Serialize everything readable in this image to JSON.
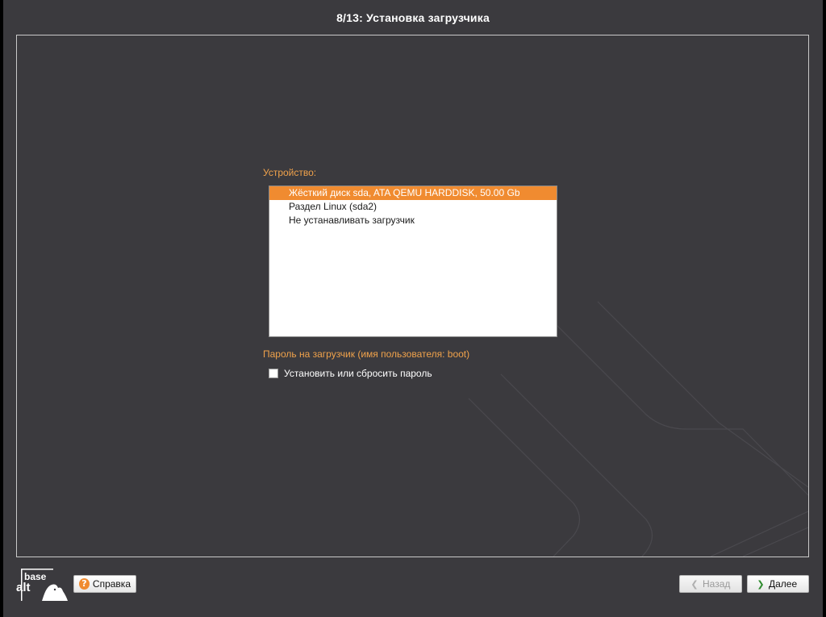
{
  "window": {
    "title": "8/13: Установка загрузчика"
  },
  "device": {
    "label": "Устройство:",
    "items": [
      {
        "label": "Жёсткий диск sda, ATA QEMU HARDDISK, 50.00 Gb",
        "selected": true
      },
      {
        "label": "Раздел Linux (sda2)",
        "selected": false
      },
      {
        "label": "Не устанавливать загрузчик",
        "selected": false
      }
    ]
  },
  "password": {
    "label": "Пароль на загрузчик (имя пользователя: boot)",
    "checkbox_label": "Установить или сбросить пароль",
    "checked": false
  },
  "logo": {
    "line1": "base",
    "line2": "alt"
  },
  "footer": {
    "help_label": "Справка",
    "back_label": "Назад",
    "next_label": "Далее"
  },
  "icons": {
    "help": "question-circle-icon",
    "back": "chevron-left-icon",
    "next": "chevron-right-icon"
  },
  "colors": {
    "background": "#3b3a3e",
    "accent": "#f08b30",
    "label": "#f0a24b",
    "next_arrow": "#2e8b2e"
  }
}
